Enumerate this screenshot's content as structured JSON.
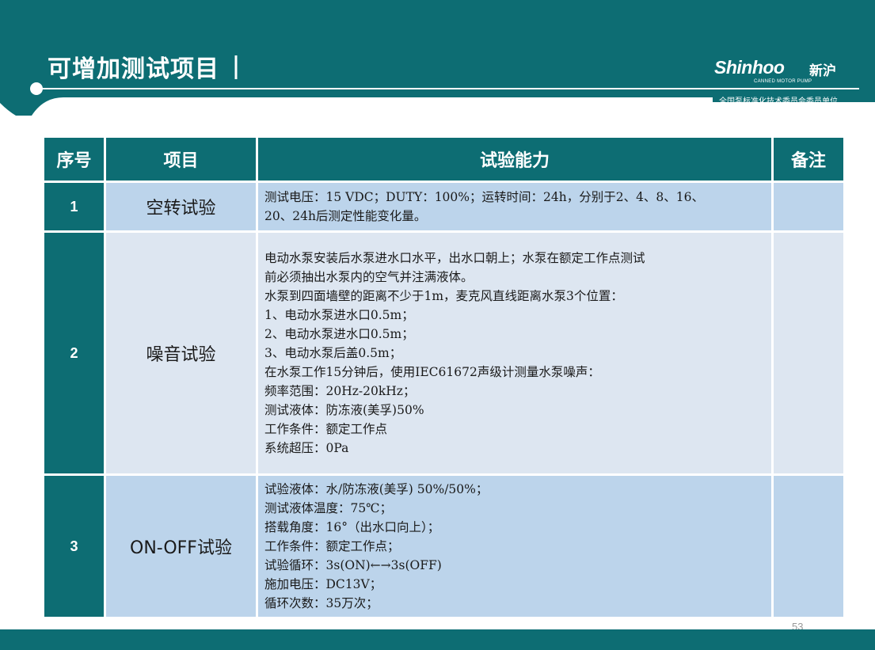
{
  "header": {
    "title": "可增加测试项目",
    "logo_brand": "Shinhoo",
    "logo_cn": "新沪",
    "logo_sub": "CANNED MOTOR PUMP",
    "committee": "全国泵标准化技术委员会委员单位"
  },
  "table": {
    "headers": [
      "序号",
      "项目",
      "试验能力",
      "备注"
    ],
    "rows": [
      {
        "index": "1",
        "item": "空转试验",
        "capability": [
          "测试电压：15 VDC；DUTY：100%；运转时间：24h，分别于2、4、8、16、",
          "20、24h后测定性能变化量。"
        ],
        "note": ""
      },
      {
        "index": "2",
        "item": "噪音试验",
        "capability": [
          "电动水泵安装后水泵进水口水平，出水口朝上；水泵在额定工作点测试",
          "前必须抽出水泵内的空气并注满液体。",
          "水泵到四面墙壁的距离不少于1m，麦克风直线距离水泵3个位置：",
          "1、电动水泵进水口0.5m；",
          "2、电动水泵进水口0.5m；",
          "3、电动水泵后盖0.5m；",
          "在水泵工作15分钟后，使用IEC61672声级计测量水泵噪声：",
          "频率范围：20Hz-20kHz；",
          "测试液体：防冻液(美孚)50%",
          "工作条件：额定工作点",
          "系统超压：0Pa"
        ],
        "note": ""
      },
      {
        "index": "3",
        "item": "ON-OFF试验",
        "capability": [
          "试验液体：水/防冻液(美孚) 50%/50%；",
          "测试液体温度：75℃；",
          "搭载角度：16°（出水口向上）；",
          "工作条件：额定工作点；",
          "试验循环：3s(ON)←→3s(OFF)",
          "施加电压：DC13V；",
          "循环次数：35万次；"
        ],
        "note": ""
      }
    ]
  },
  "footer": {
    "page_number": "53"
  },
  "colors": {
    "teal": "#0d6d73",
    "row_blue": "#bcd4eb",
    "row_light": "#dde6f1"
  }
}
